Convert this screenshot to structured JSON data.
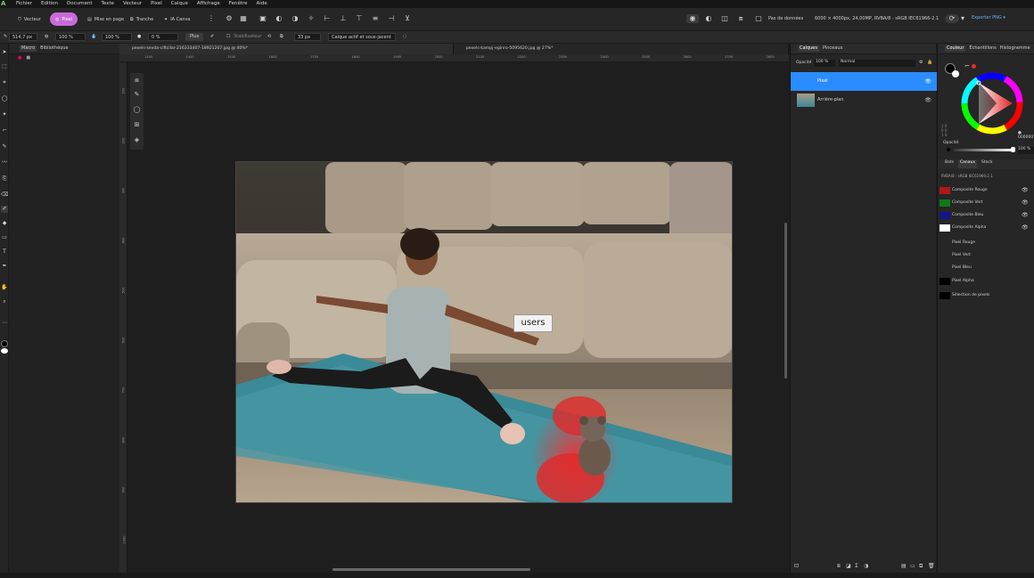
{
  "menu": [
    "Fichier",
    "Edition",
    "Document",
    "Texte",
    "Vecteur",
    "Pixel",
    "Calque",
    "Affichage",
    "Fenêtre",
    "Aide"
  ],
  "toolbar": {
    "personas": [
      {
        "label": "Vecteur",
        "active": false
      },
      {
        "label": "Pixel",
        "active": true
      },
      {
        "label": "Mise en page",
        "active": false
      },
      {
        "label": "Tranche",
        "active": false
      },
      {
        "label": "IA Canva",
        "active": false
      }
    ],
    "doc_info_label": "Pas de données",
    "doc_info": "6000 × 4000px, 24,00MP, RVBA/8 - sRGB IEC61966-2.1",
    "export_label": "Exporter PNG"
  },
  "context": {
    "width": "514,7 px",
    "opacity": "100 %",
    "flow": "100 %",
    "hardness": "0 %",
    "more": "Plus",
    "stabilizer": "Stabilisateur",
    "size2": "33 px",
    "source": "Calque actif et sous-jacent"
  },
  "left_panel": {
    "tabs": [
      "Macro",
      "Bibliothèque"
    ]
  },
  "doc_tabs": [
    {
      "label": "pexels-sevda-ciftcilar-216333407-18921207.jpg @ 40%*",
      "selected": true
    },
    {
      "label": "pexels-kampj-eginro-5095620.jpg @ 27%*",
      "selected": false
    }
  ],
  "ruler": {
    "h": [
      "1300",
      "1400",
      "1500",
      "1600",
      "1700",
      "1800",
      "1900",
      "2000",
      "2100",
      "2200",
      "2300",
      "2400",
      "2500",
      "2600",
      "2700",
      "2800",
      "2900"
    ],
    "v": [
      "100",
      "200",
      "300",
      "400",
      "500",
      "600",
      "700",
      "800",
      "900",
      "1000"
    ]
  },
  "canvas": {
    "tooltip": "users"
  },
  "layers_panel": {
    "tabs": [
      "Calques",
      "Pinceaux"
    ],
    "opacity_label": "Opacité",
    "opacity": "100 %",
    "blend": "Normal",
    "layers": [
      {
        "name": "Pixel",
        "selected": true
      },
      {
        "name": "Arrière-plan",
        "selected": false
      }
    ]
  },
  "color_panel": {
    "tabs": [
      "Couleur",
      "Échantillons",
      "Histogramme"
    ],
    "opacity_label": "Opacité",
    "opacity": "100 %",
    "hex": "000000",
    "sub_tabs": [
      "Bots",
      "Canaux",
      "Stock"
    ],
    "profile": "RVBA/8 - sRGB IEC61966-2.1",
    "channels": [
      {
        "name": "Composite Rouge",
        "swatch": "#b01818"
      },
      {
        "name": "Composite Vert",
        "swatch": "#0f7a1a"
      },
      {
        "name": "Composite Bleu",
        "swatch": "#14148a"
      },
      {
        "name": "Composite Alpha",
        "swatch": "#ffffff"
      },
      {
        "name": "Pixel Rouge",
        "swatch": ""
      },
      {
        "name": "Pixel Vert",
        "swatch": ""
      },
      {
        "name": "Pixel Bleu",
        "swatch": ""
      },
      {
        "name": "Pixel Alpha",
        "swatch": "#000000"
      },
      {
        "name": "Sélection de pixels",
        "swatch": "#000000"
      }
    ]
  },
  "colors": {
    "accent": "#2b8cff",
    "pixel_persona": "#c86bd8",
    "paint": "#e03030"
  }
}
